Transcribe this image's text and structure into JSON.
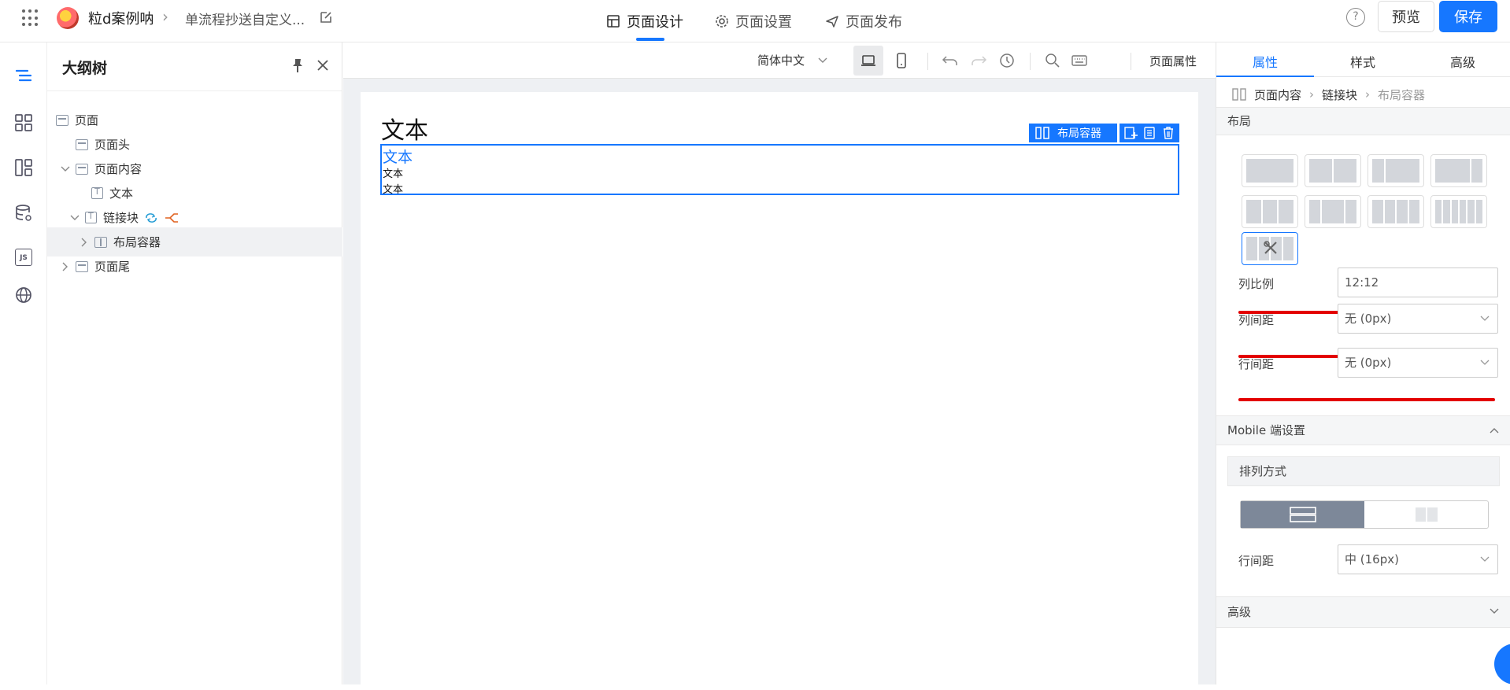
{
  "topbar": {
    "app_name": "粒d案例呐",
    "doc_name": "单流程抄送自定义...",
    "modes": [
      {
        "label": "页面设计",
        "icon": "layout-icon",
        "active": true
      },
      {
        "label": "页面设置",
        "icon": "gear-icon",
        "active": false
      },
      {
        "label": "页面发布",
        "icon": "send-icon",
        "active": false
      }
    ],
    "help": "?",
    "preview_label": "预览",
    "save_label": "保存"
  },
  "rail": {
    "items": [
      "outline-icon",
      "components-icon",
      "layout-panel-icon",
      "datasource-icon",
      "js-icon",
      "globe-icon"
    ],
    "js_label": "JS"
  },
  "outline": {
    "title": "大纲树",
    "nodes": [
      {
        "label": "页面",
        "depth": 0,
        "caret": "none"
      },
      {
        "label": "页面头",
        "depth": 1,
        "caret": "none"
      },
      {
        "label": "页面内容",
        "depth": 1,
        "caret": "down"
      },
      {
        "label": "文本",
        "depth": 2,
        "caret": "none"
      },
      {
        "label": "链接块",
        "depth": 2,
        "caret": "down"
      },
      {
        "label": "布局容器",
        "depth": 3,
        "caret": "right",
        "selected": true
      },
      {
        "label": "页面尾",
        "depth": 1,
        "caret": "right"
      }
    ]
  },
  "canvas": {
    "language": "简体中文",
    "page_props": "页面属性",
    "title_text": "文本",
    "link_text": "文本",
    "text1": "文本",
    "text2": "文本",
    "selection_tag": "布局容器"
  },
  "props": {
    "tabs": [
      "属性",
      "样式",
      "高级"
    ],
    "active_tab": "属性",
    "breadcrumb": [
      "页面内容",
      "链接块",
      "布局容器"
    ],
    "layout_section": "布局",
    "column_ratio_label": "列比例",
    "column_ratio_value": "12:12",
    "column_gap_label": "列间距",
    "column_gap_value": "无 (0px)",
    "row_gap_label": "行间距",
    "row_gap_value": "无 (0px)",
    "mobile_section": "Mobile 端设置",
    "arrange_label": "排列方式",
    "mobile_row_gap_label": "行间距",
    "mobile_row_gap_value": "中 (16px)",
    "advanced_section": "高级"
  },
  "colors": {
    "accent": "#1677ff",
    "annotation_red": "#e30000",
    "segment_active": "#7d8899"
  }
}
